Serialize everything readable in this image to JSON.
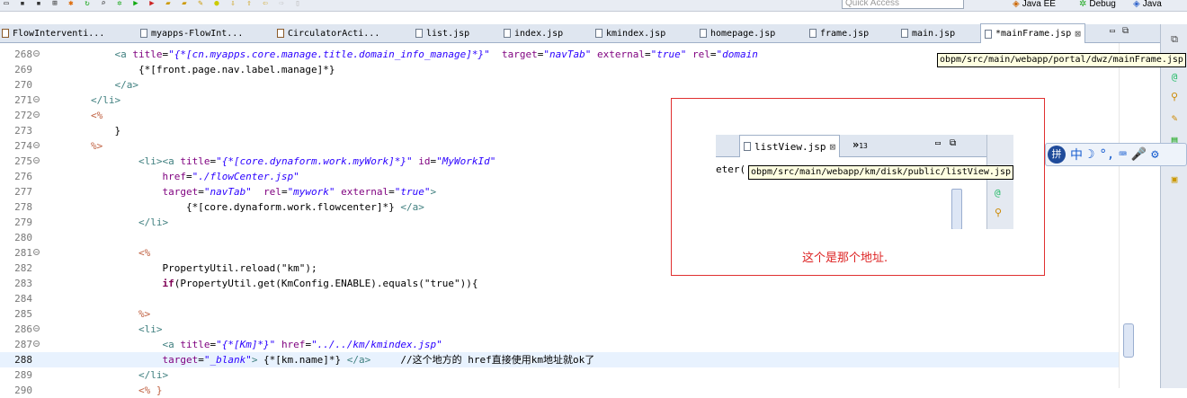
{
  "toolbar": {
    "quick_access_placeholder": "Quick Access",
    "perspectives": [
      {
        "icon": "java-ee-icon",
        "label": "Java EE"
      },
      {
        "icon": "debug-icon",
        "label": "Debug"
      },
      {
        "icon": "java-icon",
        "label": "Java"
      }
    ]
  },
  "tabs": [
    {
      "label": "FlowInterventi...",
      "icon": "java-file-icon",
      "active": false
    },
    {
      "label": "myapps-FlowInt...",
      "icon": "xml-file-icon",
      "active": false
    },
    {
      "label": "CirculatorActi...",
      "icon": "java-file-icon",
      "active": false
    },
    {
      "label": "list.jsp",
      "icon": "jsp-file-icon",
      "active": false
    },
    {
      "label": "index.jsp",
      "icon": "jsp-file-icon",
      "active": false
    },
    {
      "label": "kmindex.jsp",
      "icon": "jsp-file-icon",
      "active": false
    },
    {
      "label": "homepage.jsp",
      "icon": "jsp-file-icon",
      "active": false
    },
    {
      "label": "frame.jsp",
      "icon": "jsp-file-icon",
      "active": false
    },
    {
      "label": "main.jsp",
      "icon": "jsp-file-icon",
      "active": false
    },
    {
      "label": "*mainFrame.jsp",
      "icon": "jsp-file-icon",
      "active": true
    }
  ],
  "tooltips": {
    "main": "obpm/src/main/webapp/portal/dwz/mainFrame.jsp",
    "inset": "obpm/src/main/webapp/km/disk/public/listView.jsp"
  },
  "editor": {
    "current_line": 288,
    "lines": [
      {
        "num": 268,
        "fold": true,
        "tokens": [
          [
            "txt",
            "            "
          ],
          [
            "tag",
            "<a"
          ],
          [
            "txt",
            " "
          ],
          [
            "attr",
            "title"
          ],
          [
            "txt",
            "="
          ],
          [
            "val",
            "\"{*[cn.myapps.core.manage.title.domain_info_manage]*}\""
          ],
          [
            "txt",
            "  "
          ],
          [
            "attr",
            "target"
          ],
          [
            "txt",
            "="
          ],
          [
            "val",
            "\"navTab\""
          ],
          [
            "txt",
            " "
          ],
          [
            "attr",
            "external"
          ],
          [
            "txt",
            "="
          ],
          [
            "val",
            "\"true\""
          ],
          [
            "txt",
            " "
          ],
          [
            "attr",
            "rel"
          ],
          [
            "txt",
            "="
          ],
          [
            "val",
            "\"domain"
          ]
        ]
      },
      {
        "num": 269,
        "fold": false,
        "tokens": [
          [
            "txt",
            "                {*[front.page.nav.label.manage]*}"
          ]
        ]
      },
      {
        "num": 270,
        "fold": false,
        "tokens": [
          [
            "txt",
            "            "
          ],
          [
            "tag",
            "</a>"
          ]
        ]
      },
      {
        "num": 271,
        "fold": true,
        "tokens": [
          [
            "txt",
            "        "
          ],
          [
            "tag",
            "</li>"
          ]
        ]
      },
      {
        "num": 272,
        "fold": true,
        "tokens": [
          [
            "txt",
            "        "
          ],
          [
            "jsp",
            "<%"
          ]
        ]
      },
      {
        "num": 273,
        "fold": false,
        "tokens": [
          [
            "txt",
            "            }"
          ]
        ]
      },
      {
        "num": 274,
        "fold": true,
        "tokens": [
          [
            "txt",
            "        "
          ],
          [
            "jsp",
            "%>"
          ]
        ]
      },
      {
        "num": 275,
        "fold": true,
        "tokens": [
          [
            "txt",
            "                "
          ],
          [
            "tag",
            "<li><a"
          ],
          [
            "txt",
            " "
          ],
          [
            "attr",
            "title"
          ],
          [
            "txt",
            "="
          ],
          [
            "val",
            "\"{*[core.dynaform.work.myWork]*}\""
          ],
          [
            "txt",
            " "
          ],
          [
            "attr",
            "id"
          ],
          [
            "txt",
            "="
          ],
          [
            "val",
            "\"MyWorkId\""
          ]
        ]
      },
      {
        "num": 276,
        "fold": false,
        "tokens": [
          [
            "txt",
            "                    "
          ],
          [
            "attr",
            "href"
          ],
          [
            "txt",
            "="
          ],
          [
            "val",
            "\"./flowCenter.jsp\""
          ]
        ]
      },
      {
        "num": 277,
        "fold": false,
        "tokens": [
          [
            "txt",
            "                    "
          ],
          [
            "attr",
            "target"
          ],
          [
            "txt",
            "="
          ],
          [
            "val",
            "\"navTab\""
          ],
          [
            "txt",
            "  "
          ],
          [
            "attr",
            "rel"
          ],
          [
            "txt",
            "="
          ],
          [
            "val",
            "\"mywork\""
          ],
          [
            "txt",
            " "
          ],
          [
            "attr",
            "external"
          ],
          [
            "txt",
            "="
          ],
          [
            "val",
            "\"true\""
          ],
          [
            "tag",
            ">"
          ]
        ]
      },
      {
        "num": 278,
        "fold": false,
        "tokens": [
          [
            "txt",
            "                        {*[core.dynaform.work.flowcenter]*} "
          ],
          [
            "tag",
            "</a>"
          ]
        ]
      },
      {
        "num": 279,
        "fold": false,
        "tokens": [
          [
            "txt",
            "                "
          ],
          [
            "tag",
            "</li>"
          ]
        ]
      },
      {
        "num": 280,
        "fold": false,
        "tokens": [
          [
            "txt",
            ""
          ]
        ]
      },
      {
        "num": 281,
        "fold": true,
        "tokens": [
          [
            "txt",
            "                "
          ],
          [
            "jsp",
            "<%"
          ]
        ]
      },
      {
        "num": 282,
        "fold": false,
        "tokens": [
          [
            "txt",
            "                    PropertyUtil.reload(\"km\");"
          ]
        ]
      },
      {
        "num": 283,
        "fold": false,
        "tokens": [
          [
            "txt",
            "                    "
          ],
          [
            "kw",
            "if"
          ],
          [
            "txt",
            "(PropertyUtil.get(KmConfig.ENABLE).equals(\"true\")){"
          ]
        ]
      },
      {
        "num": 284,
        "fold": false,
        "tokens": [
          [
            "txt",
            ""
          ]
        ]
      },
      {
        "num": 285,
        "fold": false,
        "tokens": [
          [
            "txt",
            "                "
          ],
          [
            "jsp",
            "%>"
          ]
        ]
      },
      {
        "num": 286,
        "fold": true,
        "tokens": [
          [
            "txt",
            "                "
          ],
          [
            "tag",
            "<li>"
          ]
        ]
      },
      {
        "num": 287,
        "fold": true,
        "tokens": [
          [
            "txt",
            "                    "
          ],
          [
            "tag",
            "<a"
          ],
          [
            "txt",
            " "
          ],
          [
            "attr",
            "title"
          ],
          [
            "txt",
            "="
          ],
          [
            "val",
            "\"{*[Km]*}\""
          ],
          [
            "txt",
            " "
          ],
          [
            "attr",
            "href"
          ],
          [
            "txt",
            "="
          ],
          [
            "val",
            "\"../../km/kmindex.jsp\""
          ]
        ]
      },
      {
        "num": 288,
        "fold": false,
        "tokens": [
          [
            "txt",
            "                    "
          ],
          [
            "attr",
            "target"
          ],
          [
            "txt",
            "="
          ],
          [
            "val",
            "\"_blank\""
          ],
          [
            "tag",
            ">"
          ],
          [
            "txt",
            " {*[km.name]*} "
          ],
          [
            "tag",
            "</a>"
          ],
          [
            "txt",
            "     "
          ],
          [
            "cmt",
            "//这个地方的 href直接使用km地址就ok了"
          ]
        ]
      },
      {
        "num": 289,
        "fold": false,
        "tokens": [
          [
            "txt",
            "                "
          ],
          [
            "tag",
            "</li>"
          ]
        ]
      },
      {
        "num": 290,
        "fold": false,
        "tokens": [
          [
            "txt",
            "                "
          ],
          [
            "jsp",
            "<% }"
          ]
        ]
      }
    ]
  },
  "annotation": {
    "inset_tab_label": "listView.jsp",
    "inset_overflow": "»",
    "inset_overflow_count": "13",
    "inset_text": "eter(",
    "caption": "这个是那个地址."
  },
  "ime": {
    "logo": "拼",
    "items": [
      "中",
      "☽",
      "°,",
      "⌨",
      "🎤",
      "⚙"
    ]
  }
}
